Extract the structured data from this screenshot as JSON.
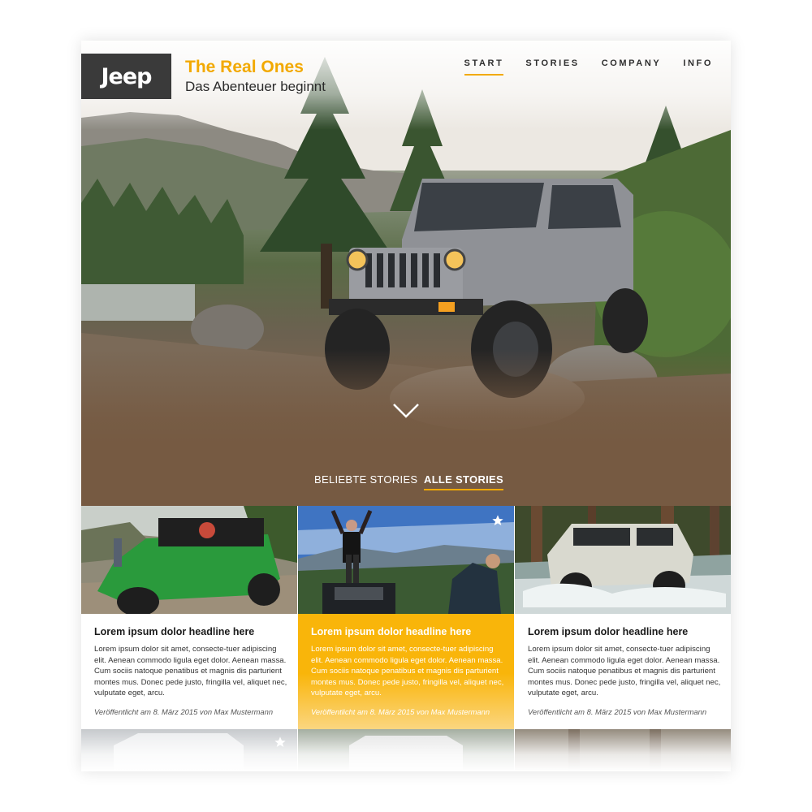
{
  "brand": {
    "logo_text": "Jeep",
    "title": "The Real Ones",
    "subtitle": "Das Abenteuer beginnt"
  },
  "nav": {
    "items": [
      {
        "label": "START",
        "active": true
      },
      {
        "label": "STORIES",
        "active": false
      },
      {
        "label": "COMPANY",
        "active": false
      },
      {
        "label": "INFO",
        "active": false
      }
    ]
  },
  "hero": {
    "icon": "chevron-down-icon"
  },
  "tabs": [
    {
      "label": "BELIEBTE STORIES",
      "active": false
    },
    {
      "label": "ALLE STORIES",
      "active": true
    }
  ],
  "cards": [
    {
      "headline": "Lorem ipsum dolor headline here",
      "body": "Lorem ipsum dolor sit amet, consecte-tuer adipiscing elit. Aenean commodo ligula eget dolor. Aenean massa. Cum sociis natoque penatibus et magnis dis parturient montes mus. Donec pede justo, fringilla vel, aliquet nec, vulputate eget, arcu.",
      "meta": "Veröffentlicht am 8. März 2015 von Max Mustermann",
      "featured": false
    },
    {
      "headline": "Lorem ipsum dolor headline here",
      "body": "Lorem ipsum dolor sit amet, consecte-tuer adipiscing elit. Aenean commodo ligula eget dolor. Aenean massa. Cum sociis natoque penatibus et magnis dis parturient montes mus. Donec pede justo, fringilla vel, aliquet nec, vulputate eget, arcu.",
      "meta": "Veröffentlicht am 8. März 2015 von Max Mustermann",
      "featured": true
    },
    {
      "headline": "Lorem ipsum dolor headline here",
      "body": "Lorem ipsum dolor sit amet, consecte-tuer adipiscing elit. Aenean commodo ligula eget dolor. Aenean massa. Cum sociis natoque penatibus et magnis dis parturient montes mus. Donec pede justo, fringilla vel, aliquet nec, vulputate eget, arcu.",
      "meta": "Veröffentlicht am 8. März 2015 von Max Mustermann",
      "featured": false
    }
  ],
  "colors": {
    "accent": "#f2a900",
    "tabs_bar": "#765a42",
    "logo_box": "#3a3a3a"
  }
}
